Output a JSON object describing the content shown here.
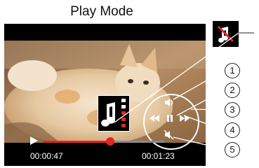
{
  "title": "Play Mode",
  "playback": {
    "elapsed": "00:00:47",
    "total": "00:01:23",
    "progress": 0.55,
    "state": "playing"
  },
  "callouts": [
    "1",
    "2",
    "3",
    "4",
    "5"
  ],
  "icons": {
    "mute": "speaker-muted-icon",
    "music": "music-note-icon",
    "volume": "volume-icon",
    "rewind": "rewind-icon",
    "pause": "pause-icon",
    "forward": "fast-forward-icon",
    "mute_toggle": "mute-icon",
    "play": "play-icon"
  },
  "colors": {
    "accent": "#e52420",
    "screen": "#000000"
  }
}
